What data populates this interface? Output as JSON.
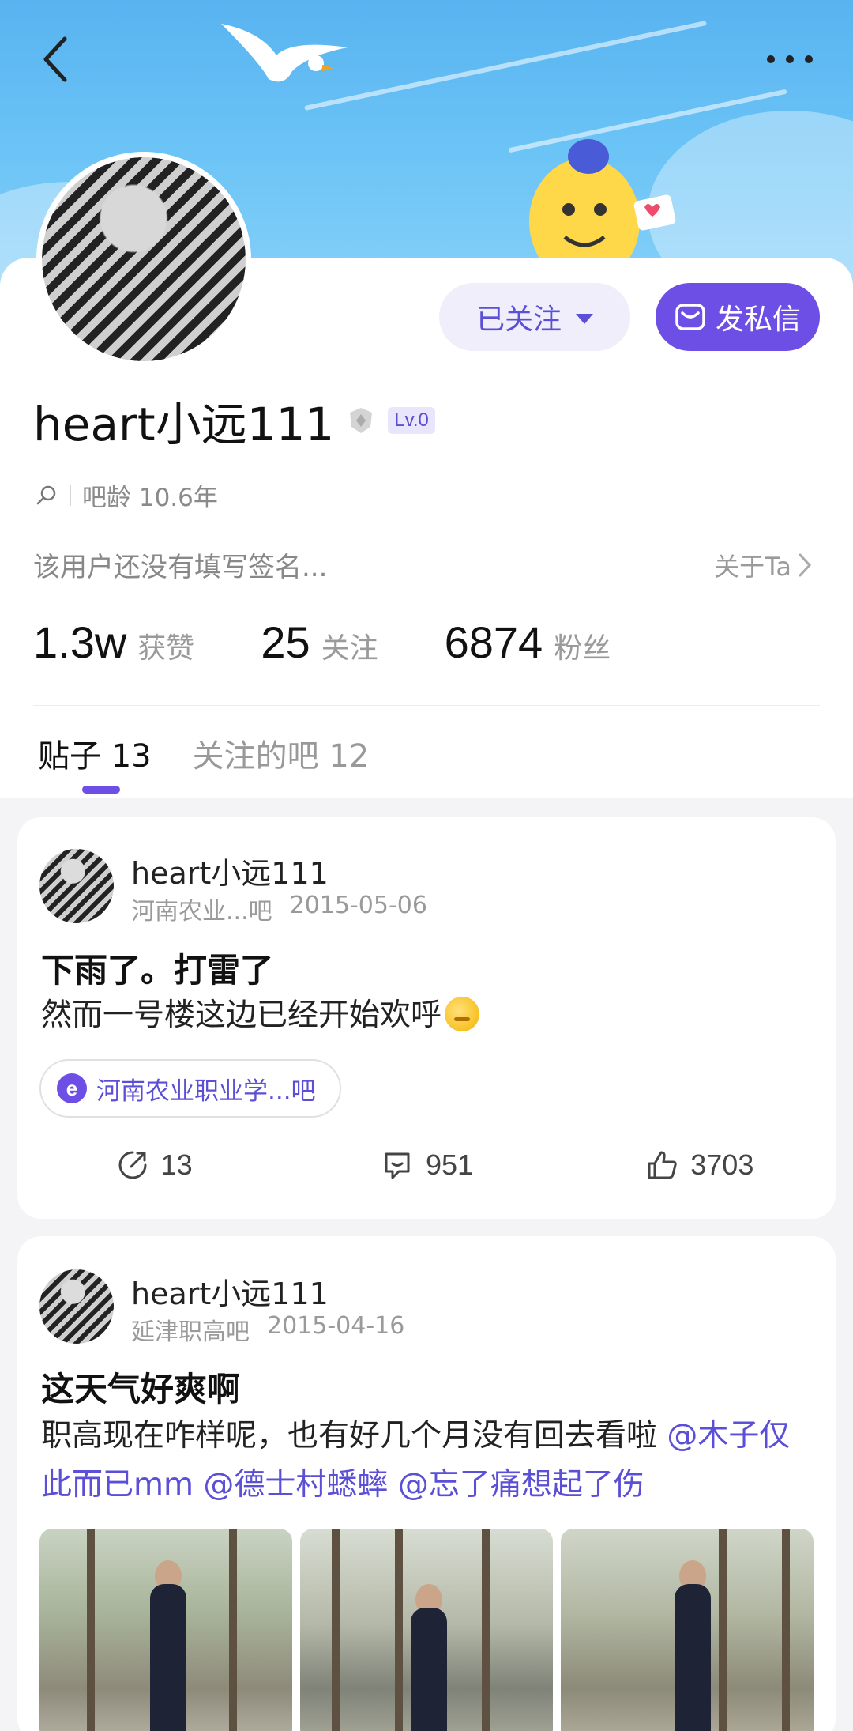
{
  "header": {
    "back_icon": "chevron-left-icon",
    "more_icon": "more-dots-icon"
  },
  "profile": {
    "username": "heart小远111",
    "level_badge": "Lv.0",
    "bar_age": "吧龄 10.6年",
    "signature": "该用户还没有填写签名...",
    "about_label": "关于Ta",
    "follow_button": "已关注",
    "message_button": "发私信",
    "stats": [
      {
        "value": "1.3w",
        "label": "获赞"
      },
      {
        "value": "25",
        "label": "关注"
      },
      {
        "value": "6874",
        "label": "粉丝"
      }
    ]
  },
  "tabs": [
    {
      "label": "贴子 13",
      "active": true
    },
    {
      "label": "关注的吧 12",
      "active": false
    }
  ],
  "posts": [
    {
      "author": "heart小远111",
      "forum": "河南农业...吧",
      "date": "2015-05-06",
      "title": "下雨了。打雷了",
      "body": "然而一号楼这边已经开始欢呼",
      "tag": "河南农业职业学...吧",
      "shares": "13",
      "comments": "951",
      "likes": "3703"
    },
    {
      "author": "heart小远111",
      "forum": "延津职高吧",
      "date": "2015-04-16",
      "title": "这天气好爽啊",
      "body_text": "职高现在咋样呢，也有好几个月没有回去看啦 ",
      "mentions": [
        "@木子仅此而已mm",
        "@德士村蟋蟀",
        "@忘了痛想起了伤"
      ]
    }
  ],
  "colors": {
    "accent": "#6e4fe6",
    "accent_soft": "#efeefa",
    "banner_sky": "#5fb8f2",
    "muted_text": "#9a9a9a"
  }
}
